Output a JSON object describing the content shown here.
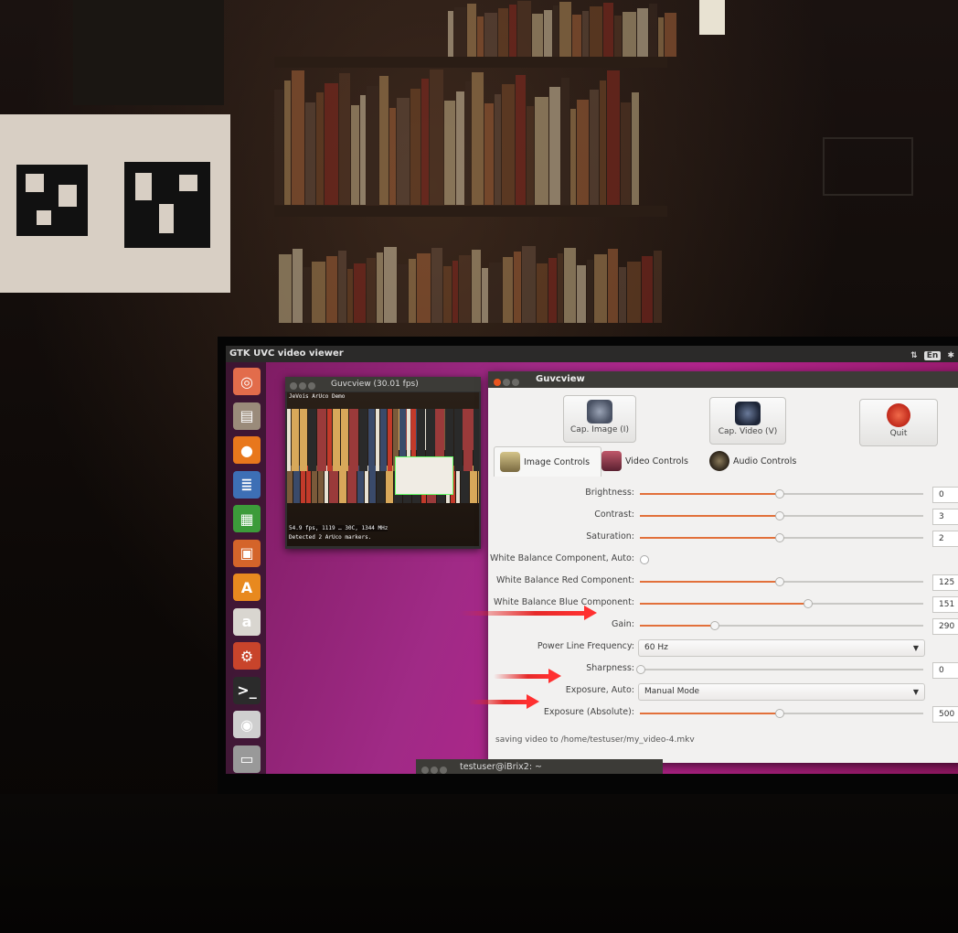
{
  "top_panel": {
    "title": "GTK UVC video viewer",
    "keyboard_indicator": "En"
  },
  "launcher": {
    "items": [
      {
        "name": "ubuntu-dash",
        "glyph": "◎",
        "color": "#e26c4b"
      },
      {
        "name": "files",
        "glyph": "▤",
        "color": "#9a8b7a"
      },
      {
        "name": "firefox",
        "glyph": "●",
        "color": "#e8771c"
      },
      {
        "name": "writer",
        "glyph": "≣",
        "color": "#3d6fb5"
      },
      {
        "name": "calc",
        "glyph": "▦",
        "color": "#3c9b3a"
      },
      {
        "name": "impress",
        "glyph": "▣",
        "color": "#d4642a"
      },
      {
        "name": "software-center",
        "glyph": "A",
        "color": "#e8891f"
      },
      {
        "name": "amazon",
        "glyph": "a",
        "color": "#d9d6d0"
      },
      {
        "name": "settings",
        "glyph": "⚙",
        "color": "#c8442b"
      },
      {
        "name": "terminal",
        "glyph": ">_",
        "color": "#2b2b2b"
      },
      {
        "name": "webcam",
        "glyph": "◉",
        "color": "#cfcfcf"
      },
      {
        "name": "trash",
        "glyph": "▭",
        "color": "#999"
      }
    ]
  },
  "preview_window": {
    "title": "Guvcview  (30.01 fps)",
    "overlay_top": "JeVois ArUco Demo",
    "overlay_fps": "54.9 fps, 1119 …  30C, 1344 MHz",
    "overlay_detect": "Detected 2 ArUco markers."
  },
  "control_window": {
    "title": "Guvcview",
    "buttons": {
      "cap_image": "Cap. Image (I)",
      "cap_video": "Cap. Video (V)",
      "quit": "Quit"
    },
    "tabs": [
      "Image Controls",
      "Video Controls",
      "Audio Controls"
    ],
    "controls": [
      {
        "label": "Brightness:",
        "kind": "slider",
        "value": "0",
        "fraction": 0.49
      },
      {
        "label": "Contrast:",
        "kind": "slider",
        "value": "3",
        "fraction": 0.49
      },
      {
        "label": "Saturation:",
        "kind": "slider",
        "value": "2",
        "fraction": 0.49
      },
      {
        "label": "White Balance Component, Auto:",
        "kind": "check"
      },
      {
        "label": "White Balance Red Component:",
        "kind": "slider",
        "value": "125",
        "fraction": 0.49
      },
      {
        "label": "White Balance Blue Component:",
        "kind": "slider",
        "value": "151",
        "fraction": 0.59
      },
      {
        "label": "Gain:",
        "kind": "slider",
        "value": "290",
        "fraction": 0.26
      },
      {
        "label": "Power Line Frequency:",
        "kind": "combo",
        "value": "60 Hz"
      },
      {
        "label": "Sharpness:",
        "kind": "slider",
        "value": "0",
        "fraction": 0.0
      },
      {
        "label": "Exposure, Auto:",
        "kind": "combo",
        "value": "Manual Mode"
      },
      {
        "label": "Exposure (Absolute):",
        "kind": "slider",
        "value": "500",
        "fraction": 0.49
      }
    ],
    "status": "saving video to /home/testuser/my_video-4.mkv"
  },
  "terminal": {
    "title": "testuser@iBrix2: ~"
  },
  "colors": {
    "slider_fill": "#e2703a",
    "arrow": "#e62a2a",
    "desktop": "#a02a86"
  }
}
